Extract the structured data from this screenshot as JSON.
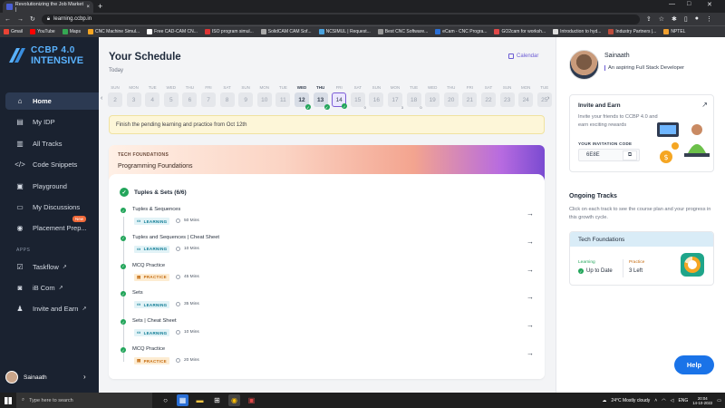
{
  "browser": {
    "tab_title": "Revolutionizing the Job Market |",
    "tab_close": "×",
    "new_tab": "+",
    "url": "learning.ccbp.in",
    "bookmarks": [
      "Gmail",
      "YouTube",
      "Maps",
      "CNC Machine Simul...",
      "Free CAD-CAM CN...",
      "ISO program simul...",
      "SolidCAM CAM Sof...",
      "NCSIMUL | Request...",
      "Best CNC Software...",
      "eCam - CNC Progra...",
      "GO2cam for worksh...",
      "Introduction to hyd...",
      "Industry Partners |...",
      "NPTEL"
    ]
  },
  "sidebar": {
    "logo_line1": "CCBP 4.0",
    "logo_line2": "INTENSIVE",
    "nav": [
      {
        "label": "Home",
        "icon": "home-icon",
        "glyph": "⌂"
      },
      {
        "label": "My IDP",
        "icon": "idp-icon",
        "glyph": "▤"
      },
      {
        "label": "All Tracks",
        "icon": "tracks-icon",
        "glyph": "▥"
      },
      {
        "label": "Code Snippets",
        "icon": "code-icon",
        "glyph": "</>"
      },
      {
        "label": "Playground",
        "icon": "playground-icon",
        "glyph": "▣"
      },
      {
        "label": "My Discussions",
        "icon": "discussions-icon",
        "glyph": "▭"
      },
      {
        "label": "Placement Prep...",
        "icon": "placement-icon",
        "glyph": "◉",
        "badge": "New"
      }
    ],
    "apps_label": "APPS",
    "apps": [
      {
        "label": "Taskflow",
        "icon": "taskflow-icon",
        "glyph": "☑"
      },
      {
        "label": "iB Com",
        "icon": "ibcom-icon",
        "glyph": "◙"
      },
      {
        "label": "Invite and Earn",
        "icon": "invite-icon",
        "glyph": "♟"
      }
    ],
    "user_name": "Sainaath"
  },
  "schedule": {
    "title": "Your Schedule",
    "today_label": "Today",
    "calendar_label": "Calendar",
    "days": [
      {
        "dn": "SUN",
        "dd": "2"
      },
      {
        "dn": "MON",
        "dd": "3"
      },
      {
        "dn": "TUE",
        "dd": "4"
      },
      {
        "dn": "WED",
        "dd": "5"
      },
      {
        "dn": "THU",
        "dd": "6"
      },
      {
        "dn": "FRI",
        "dd": "7"
      },
      {
        "dn": "SAT",
        "dd": "8"
      },
      {
        "dn": "SUN",
        "dd": "9"
      },
      {
        "dn": "MON",
        "dd": "10"
      },
      {
        "dn": "TUE",
        "dd": "11"
      },
      {
        "dn": "WED",
        "dd": "12",
        "state": "done"
      },
      {
        "dn": "THU",
        "dd": "13",
        "state": "done"
      },
      {
        "dn": "FRI",
        "dd": "14",
        "state": "sel"
      },
      {
        "dn": "SAT",
        "dd": "15",
        "state": "part",
        "sub": "0"
      },
      {
        "dn": "SUN",
        "dd": "16"
      },
      {
        "dn": "MON",
        "dd": "17",
        "state": "part",
        "sub": "3"
      },
      {
        "dn": "TUE",
        "dd": "18",
        "state": "part",
        "sub": "0"
      },
      {
        "dn": "WED",
        "dd": "19"
      },
      {
        "dn": "THU",
        "dd": "20"
      },
      {
        "dn": "FRI",
        "dd": "21"
      },
      {
        "dn": "SAT",
        "dd": "22"
      },
      {
        "dn": "SUN",
        "dd": "23"
      },
      {
        "dn": "MON",
        "dd": "24"
      },
      {
        "dn": "TUE",
        "dd": "25"
      }
    ],
    "banner": "Finish the pending learning and practice from Oct 12th"
  },
  "course": {
    "kicker": "TECH FOUNDATIONS",
    "title": "Programming Foundations",
    "section": "Tuples & Sets (6/6)",
    "items": [
      {
        "name": "Tuples & Sequences",
        "tag": "LEARNING",
        "kind": "learn",
        "dur": "50 Mins"
      },
      {
        "name": "Tuples and Sequences | Cheat Sheet",
        "tag": "LEARNING",
        "kind": "learn",
        "dur": "10 Mins"
      },
      {
        "name": "MCQ Practice",
        "tag": "PRACTICE",
        "kind": "prac",
        "dur": "45 Mins"
      },
      {
        "name": "Sets",
        "tag": "LEARNING",
        "kind": "learn",
        "dur": "35 Mins"
      },
      {
        "name": "Sets | Cheat Sheet",
        "tag": "LEARNING",
        "kind": "learn",
        "dur": "10 Mins"
      },
      {
        "name": "MCQ Practice",
        "tag": "PRACTICE",
        "kind": "prac",
        "dur": "20 Mins"
      }
    ]
  },
  "profile": {
    "name": "Sainaath",
    "tagline": "An aspiring Full Stack Developer"
  },
  "invite": {
    "title": "Invite and Earn",
    "desc": "Invite your friends to CCBP 4.0 and earn exciting rewards",
    "code_label": "YOUR INVITATION CODE",
    "code": "6E8E"
  },
  "ongoing": {
    "title": "Ongoing Tracks",
    "desc": "Click on each track to see the course plan and your progress in this growth cycle.",
    "track": "Tech Foundations",
    "learning_label": "Learning",
    "learning_value": "Up to Date",
    "practice_label": "Practice",
    "practice_value": "3 Left",
    "practice_progress": 0.8
  },
  "help_label": "Help",
  "taskbar": {
    "search_placeholder": "Type here to search",
    "weather": "24°C  Mostly cloudy",
    "lang": "ENG",
    "time": "20:04",
    "date": "14-10-2022"
  }
}
